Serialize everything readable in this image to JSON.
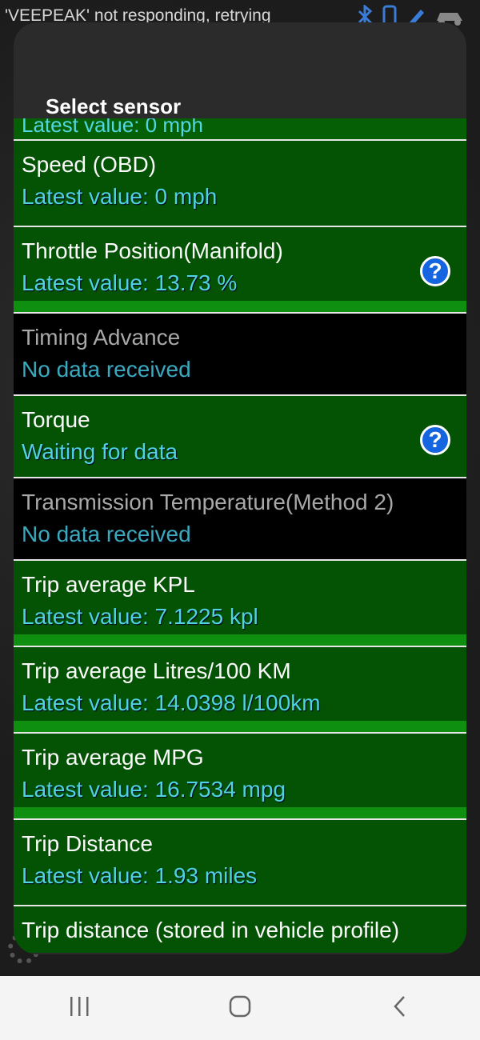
{
  "background": {
    "status_text": "'VEEPEAK' not responding, retrying"
  },
  "dialog": {
    "title": "Select sensor",
    "partial_top_text": "Latest value: 0 mph",
    "rows": [
      {
        "name": "Speed (OBD)",
        "value": "Latest value: 0 mph",
        "state": "active",
        "help": false,
        "fill": 0
      },
      {
        "name": "Throttle Position(Manifold)",
        "value": "Latest value: 13.73 %",
        "state": "active",
        "help": true,
        "fill": 1.0
      },
      {
        "name": "Timing Advance",
        "value": "No data received",
        "state": "inactive",
        "help": false,
        "fill": 0
      },
      {
        "name": "Torque",
        "value": "Waiting for data",
        "state": "active",
        "help": true,
        "fill": 0
      },
      {
        "name": "Transmission Temperature(Method 2)",
        "value": "No data received",
        "state": "inactive",
        "help": false,
        "fill": 0
      },
      {
        "name": "Trip average KPL",
        "value": "Latest value: 7.1225 kpl",
        "state": "active",
        "help": false,
        "fill": 1.0
      },
      {
        "name": "Trip average Litres/100 KM",
        "value": "Latest value: 14.0398 l/100km",
        "state": "active",
        "help": false,
        "fill": 1.0
      },
      {
        "name": "Trip average MPG",
        "value": "Latest value: 16.7534 mpg",
        "state": "active",
        "help": false,
        "fill": 1.0
      },
      {
        "name": "Trip Distance",
        "value": "Latest value: 1.93 miles",
        "state": "active",
        "help": false,
        "fill": 0
      },
      {
        "name": "Trip distance (stored in vehicle profile)",
        "value": "",
        "state": "active",
        "help": false,
        "fill": 0
      }
    ]
  },
  "help_glyph": "?",
  "navbar": {
    "recents_icon": "recents-icon",
    "home_icon": "home-icon",
    "back_icon": "back-icon"
  },
  "colors": {
    "active_row": "#045304",
    "inactive_row": "#000000",
    "value_text": "#50d2e2",
    "progress_fill": "#0f8f0f",
    "help_icon": "#1565e0"
  }
}
